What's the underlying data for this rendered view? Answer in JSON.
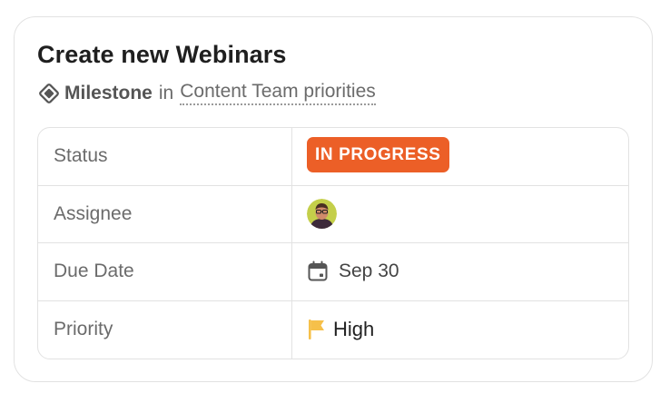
{
  "card": {
    "title": "Create new Webinars",
    "type_icon": "milestone-diamond-icon",
    "type_label": "Milestone",
    "in_word": "in",
    "parent": "Content Team priorities"
  },
  "properties": {
    "status": {
      "label": "Status",
      "value": "IN PROGRESS",
      "color": "#ec5f27"
    },
    "assignee": {
      "label": "Assignee",
      "avatar_icon": "user-avatar"
    },
    "due_date": {
      "label": "Due Date",
      "icon": "calendar-icon",
      "value": "Sep 30"
    },
    "priority": {
      "label": "Priority",
      "icon": "flag-icon",
      "value": "High",
      "flag_color": "#f6c04a"
    }
  }
}
